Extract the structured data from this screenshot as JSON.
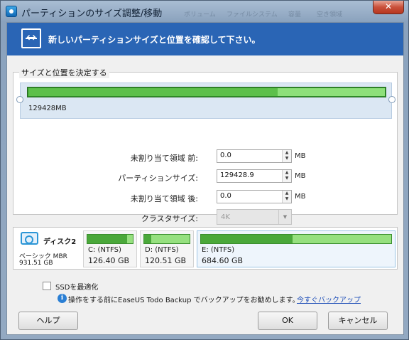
{
  "window": {
    "title": "パーティションのサイズ調整/移動",
    "ghost_header": [
      "ボリューム",
      "ファイルシステム",
      "容量",
      "空き領域"
    ],
    "close_glyph": "✕"
  },
  "banner": {
    "text": "新しいパーティションサイズと位置を確認して下さい。"
  },
  "group": {
    "legend": "サイズと位置を決定する",
    "total_size": "129428MB",
    "used_fraction": 0.7,
    "free_fraction": 0.3
  },
  "form": {
    "before": {
      "label": "未割り当て領域 前:",
      "value": "0.0",
      "unit": "MB"
    },
    "size": {
      "label": "パーティションサイズ:",
      "value": "129428.9",
      "unit": "MB"
    },
    "after": {
      "label": "未割り当て領域 後:",
      "value": "0.0",
      "unit": "MB"
    },
    "cluster": {
      "label": "クラスタサイズ:",
      "value": "4K"
    },
    "spin_up": "▲",
    "spin_down": "▼",
    "select_arrow": "▼"
  },
  "disk": {
    "name": "ディスク2",
    "type": "ベーシック MBR",
    "size": "931.51 GB",
    "partitions": [
      {
        "name": "C: (NTFS)",
        "size": "126.40 GB",
        "used_fraction": 0.88
      },
      {
        "name": "D: (NTFS)",
        "size": "120.51 GB",
        "used_fraction": 0.15
      },
      {
        "name": "E: (NTFS)",
        "size": "684.60 GB",
        "used_fraction": 0.48
      }
    ]
  },
  "options": {
    "ssd_label": "SSDを最適化",
    "ssd_checked": false,
    "info_glyph": "i",
    "info_text": "操作をする前にEaseUS Todo Backup でバックアップをお勧めします。",
    "info_link": "今すぐバックアップ"
  },
  "buttons": {
    "help": "ヘルプ",
    "ok": "OK",
    "cancel": "キャンセル"
  }
}
